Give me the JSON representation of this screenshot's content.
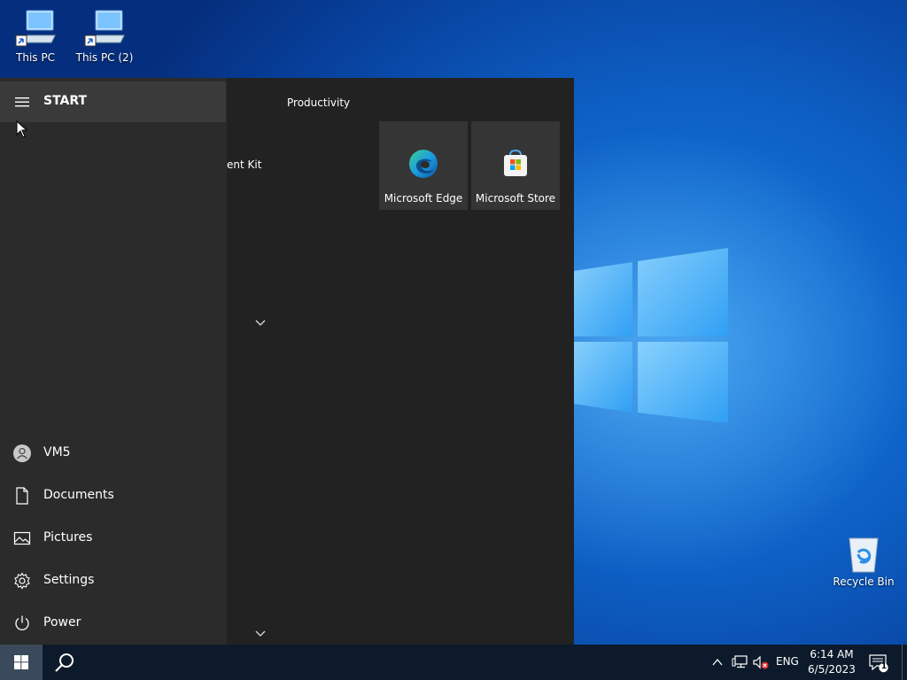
{
  "desktop": {
    "icons": [
      {
        "label": "This PC"
      },
      {
        "label": "This PC (2)"
      },
      {
        "label": "Recycle Bin"
      }
    ]
  },
  "start_menu": {
    "header_label": "START",
    "apps_fragment": "ent Kit",
    "group_title": "Productivity",
    "tiles": [
      {
        "label": "Microsoft Edge",
        "icon": "edge-icon"
      },
      {
        "label": "Microsoft Store",
        "icon": "store-icon"
      }
    ],
    "nav": {
      "user": "VM5",
      "documents": "Documents",
      "pictures": "Pictures",
      "settings": "Settings",
      "power": "Power"
    }
  },
  "taskbar": {
    "language": "ENG",
    "time": "6:14 AM",
    "date": "6/5/2023",
    "notification_count": "1"
  },
  "colors": {
    "desktop_accent": "#0d5fc4",
    "start_bg": "#222222",
    "nav_bg": "#2b2b2b",
    "tile_bg": "#353535",
    "taskbar_bg": "#0c1a2b"
  }
}
